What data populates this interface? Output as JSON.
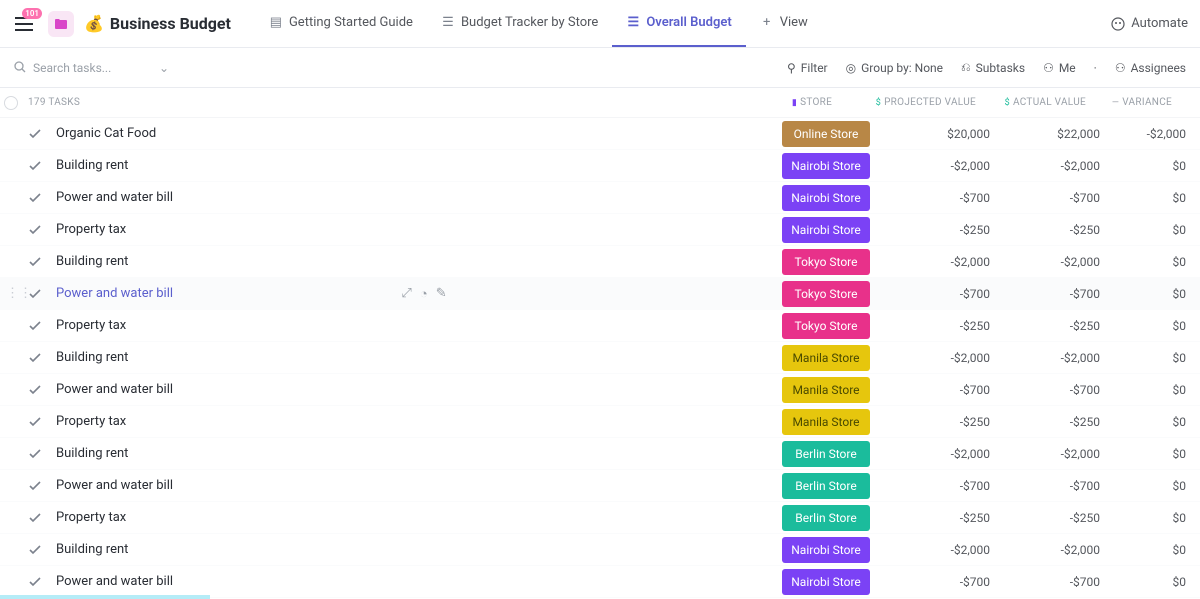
{
  "badge": "101",
  "title": "Business Budget",
  "views": {
    "started": "Getting Started Guide",
    "tracker": "Budget Tracker by Store",
    "overall": "Overall Budget",
    "addView": "View"
  },
  "automate": "Automate",
  "search": {
    "placeholder": "Search tasks..."
  },
  "toolbar": {
    "filter": "Filter",
    "groupBy": "Group by: None",
    "subtasks": "Subtasks",
    "me": "Me",
    "assignees": "Assignees"
  },
  "taskCount": "179 TASKS",
  "columns": {
    "store": "STORE",
    "projected": "PROJECTED VALUE",
    "actual": "ACTUAL VALUE",
    "variance": "VARIANCE"
  },
  "stores": {
    "online": "Online Store",
    "nairobi": "Nairobi Store",
    "tokyo": "Tokyo Store",
    "manila": "Manila Store",
    "berlin": "Berlin Store"
  },
  "rows": [
    {
      "name": "Organic Cat Food",
      "store": "online",
      "proj": "$20,000",
      "act": "$22,000",
      "var": "-$2,000"
    },
    {
      "name": "Building rent",
      "store": "nairobi",
      "proj": "-$2,000",
      "act": "-$2,000",
      "var": "$0"
    },
    {
      "name": "Power and water bill",
      "store": "nairobi",
      "proj": "-$700",
      "act": "-$700",
      "var": "$0"
    },
    {
      "name": "Property tax",
      "store": "nairobi",
      "proj": "-$250",
      "act": "-$250",
      "var": "$0"
    },
    {
      "name": "Building rent",
      "store": "tokyo",
      "proj": "-$2,000",
      "act": "-$2,000",
      "var": "$0"
    },
    {
      "name": "Power and water bill",
      "store": "tokyo",
      "proj": "-$700",
      "act": "-$700",
      "var": "$0",
      "hovered": true
    },
    {
      "name": "Property tax",
      "store": "tokyo",
      "proj": "-$250",
      "act": "-$250",
      "var": "$0"
    },
    {
      "name": "Building rent",
      "store": "manila",
      "proj": "-$2,000",
      "act": "-$2,000",
      "var": "$0"
    },
    {
      "name": "Power and water bill",
      "store": "manila",
      "proj": "-$700",
      "act": "-$700",
      "var": "$0"
    },
    {
      "name": "Property tax",
      "store": "manila",
      "proj": "-$250",
      "act": "-$250",
      "var": "$0"
    },
    {
      "name": "Building rent",
      "store": "berlin",
      "proj": "-$2,000",
      "act": "-$2,000",
      "var": "$0"
    },
    {
      "name": "Power and water bill",
      "store": "berlin",
      "proj": "-$700",
      "act": "-$700",
      "var": "$0"
    },
    {
      "name": "Property tax",
      "store": "berlin",
      "proj": "-$250",
      "act": "-$250",
      "var": "$0"
    },
    {
      "name": "Building rent",
      "store": "nairobi",
      "proj": "-$2,000",
      "act": "-$2,000",
      "var": "$0"
    },
    {
      "name": "Power and water bill",
      "store": "nairobi",
      "proj": "-$700",
      "act": "-$700",
      "var": "$0"
    }
  ]
}
